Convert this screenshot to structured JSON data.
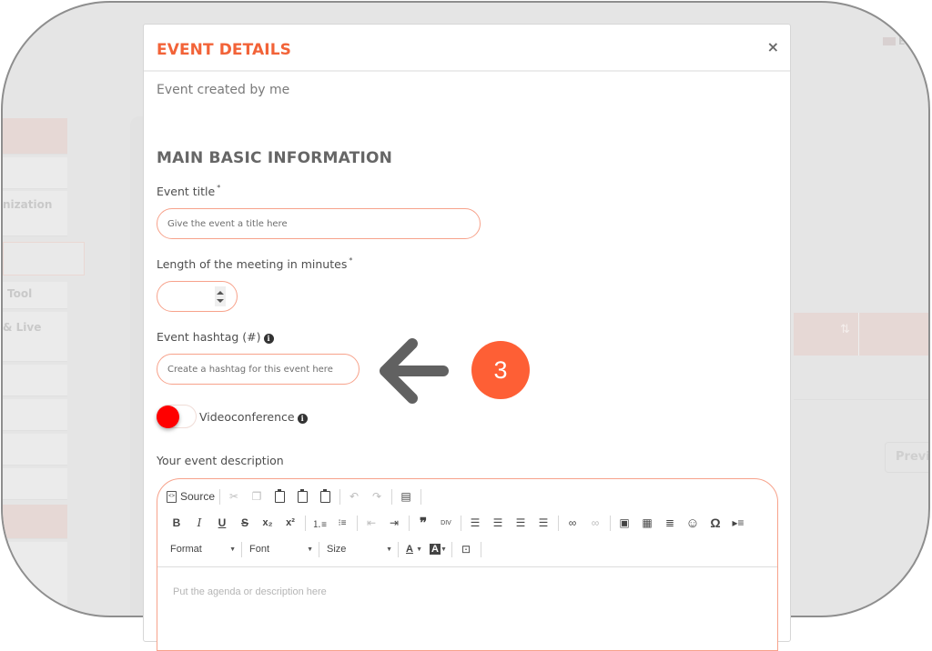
{
  "background": {
    "sidebar_fragments": [
      "nization",
      "Tool",
      "& Live"
    ],
    "language_label": "En",
    "previous_button": "Previo",
    "sort_icon": "sort-arrows-icon"
  },
  "modal": {
    "title": "EVENT DETAILS",
    "close_icon": "close-icon",
    "close_glyph": "×",
    "subtitle": "Event created by me",
    "section_title": "MAIN BASIC INFORMATION",
    "fields": {
      "title": {
        "label": "Event title",
        "required_mark": "*",
        "value": "",
        "placeholder": "Give the event a title here"
      },
      "length": {
        "label": "Length of the meeting in minutes",
        "required_mark": "*",
        "value": ""
      },
      "hashtag": {
        "label": "Event hashtag (#)",
        "info_icon": "info-icon",
        "value": "",
        "placeholder": "Create a hashtag for this event here"
      },
      "videoconference": {
        "label": "Videoconference",
        "info_icon": "info-icon",
        "enabled": false,
        "knob_color": "#ff0000"
      },
      "description": {
        "label": "Your event description",
        "placeholder": "Put the agenda or description here"
      }
    },
    "editor_toolbar": {
      "row1": [
        "Source",
        "Cut",
        "Copy",
        "Paste",
        "Paste as plain text",
        "Paste from Word",
        "Undo",
        "Redo",
        "Templates"
      ],
      "row2": [
        "Bold",
        "Italic",
        "Underline",
        "Strikethrough",
        "Subscript",
        "Superscript",
        "Numbered List",
        "Bulleted List",
        "Decrease Indent",
        "Increase Indent",
        "Blockquote",
        "Create Div",
        "Align Left",
        "Center",
        "Align Right",
        "Justify",
        "Link",
        "Unlink",
        "Image",
        "Table",
        "Horizontal Line",
        "Smiley",
        "Special Character",
        "Insert Page Break"
      ],
      "row3": {
        "format": "Format",
        "font": "Font",
        "size": "Size",
        "text_color": "A",
        "bg_color": "A"
      },
      "source_label": "Source",
      "glyphs": {
        "bold": "B",
        "italic": "I",
        "underline": "U",
        "strike": "S",
        "omega": "Ω",
        "quote": "❞",
        "smiley": "☺",
        "div": "DIV"
      }
    }
  },
  "annotation": {
    "step_number": "3",
    "arrow_icon": "arrow-left-icon",
    "badge_color": "#fe5f35"
  },
  "colors": {
    "accent": "#f26338",
    "input_border": "#f7a28b",
    "heading": "#666666"
  }
}
